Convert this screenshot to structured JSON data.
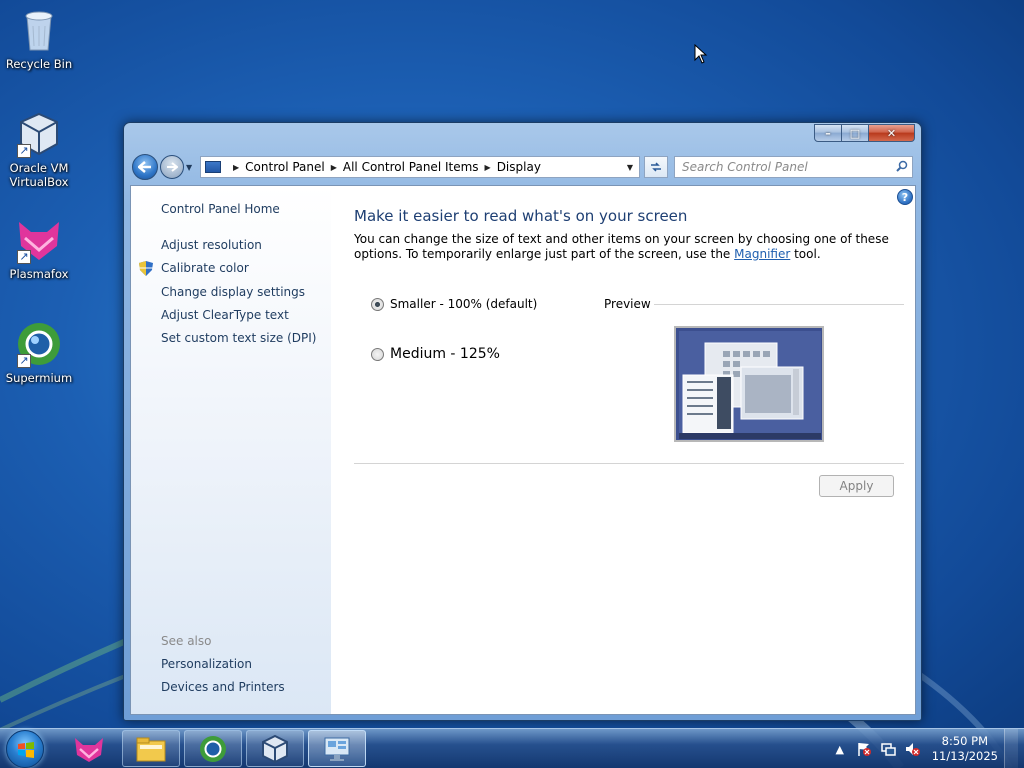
{
  "desktop": {
    "icons": [
      {
        "label": "Recycle Bin",
        "icon": "recycle-bin-icon"
      },
      {
        "label": "Oracle VM VirtualBox",
        "icon": "virtualbox-icon"
      },
      {
        "label": "Plasmafox",
        "icon": "plasmafox-icon"
      },
      {
        "label": "Supermium",
        "icon": "supermium-icon"
      }
    ]
  },
  "window": {
    "controls": {
      "minimize": "–",
      "maximize": "□",
      "close": "✕"
    },
    "nav": {
      "breadcrumb": [
        "Control Panel",
        "All Control Panel Items",
        "Display"
      ],
      "search_placeholder": "Search Control Panel"
    },
    "sidebar": {
      "home": "Control Panel Home",
      "links": [
        "Adjust resolution",
        "Calibrate color",
        "Change display settings",
        "Adjust ClearType text",
        "Set custom text size (DPI)"
      ],
      "see_also_label": "See also",
      "see_also": [
        "Personalization",
        "Devices and Printers"
      ]
    },
    "main": {
      "title": "Make it easier to read what's on your screen",
      "desc_before": "You can change the size of text and other items on your screen by choosing one of these options. To temporarily enlarge just part of the screen, use the ",
      "desc_link": "Magnifier",
      "desc_after": " tool.",
      "options": [
        {
          "label": "Smaller - 100% (default)",
          "checked": true
        },
        {
          "label": "Medium - 125%",
          "checked": false
        }
      ],
      "preview_label": "Preview",
      "apply": "Apply",
      "help": "?"
    }
  },
  "taskbar": {
    "apps": [
      "plasmafox",
      "file-explorer",
      "supermium",
      "virtualbox",
      "control-panel"
    ],
    "clock_time": "8:50 PM",
    "clock_date": "11/13/2025",
    "tray_chevron": "▲"
  },
  "colors": {
    "link": "#1e3b5f",
    "title": "#1e3f73",
    "hyperlink": "#1f5fb0"
  }
}
